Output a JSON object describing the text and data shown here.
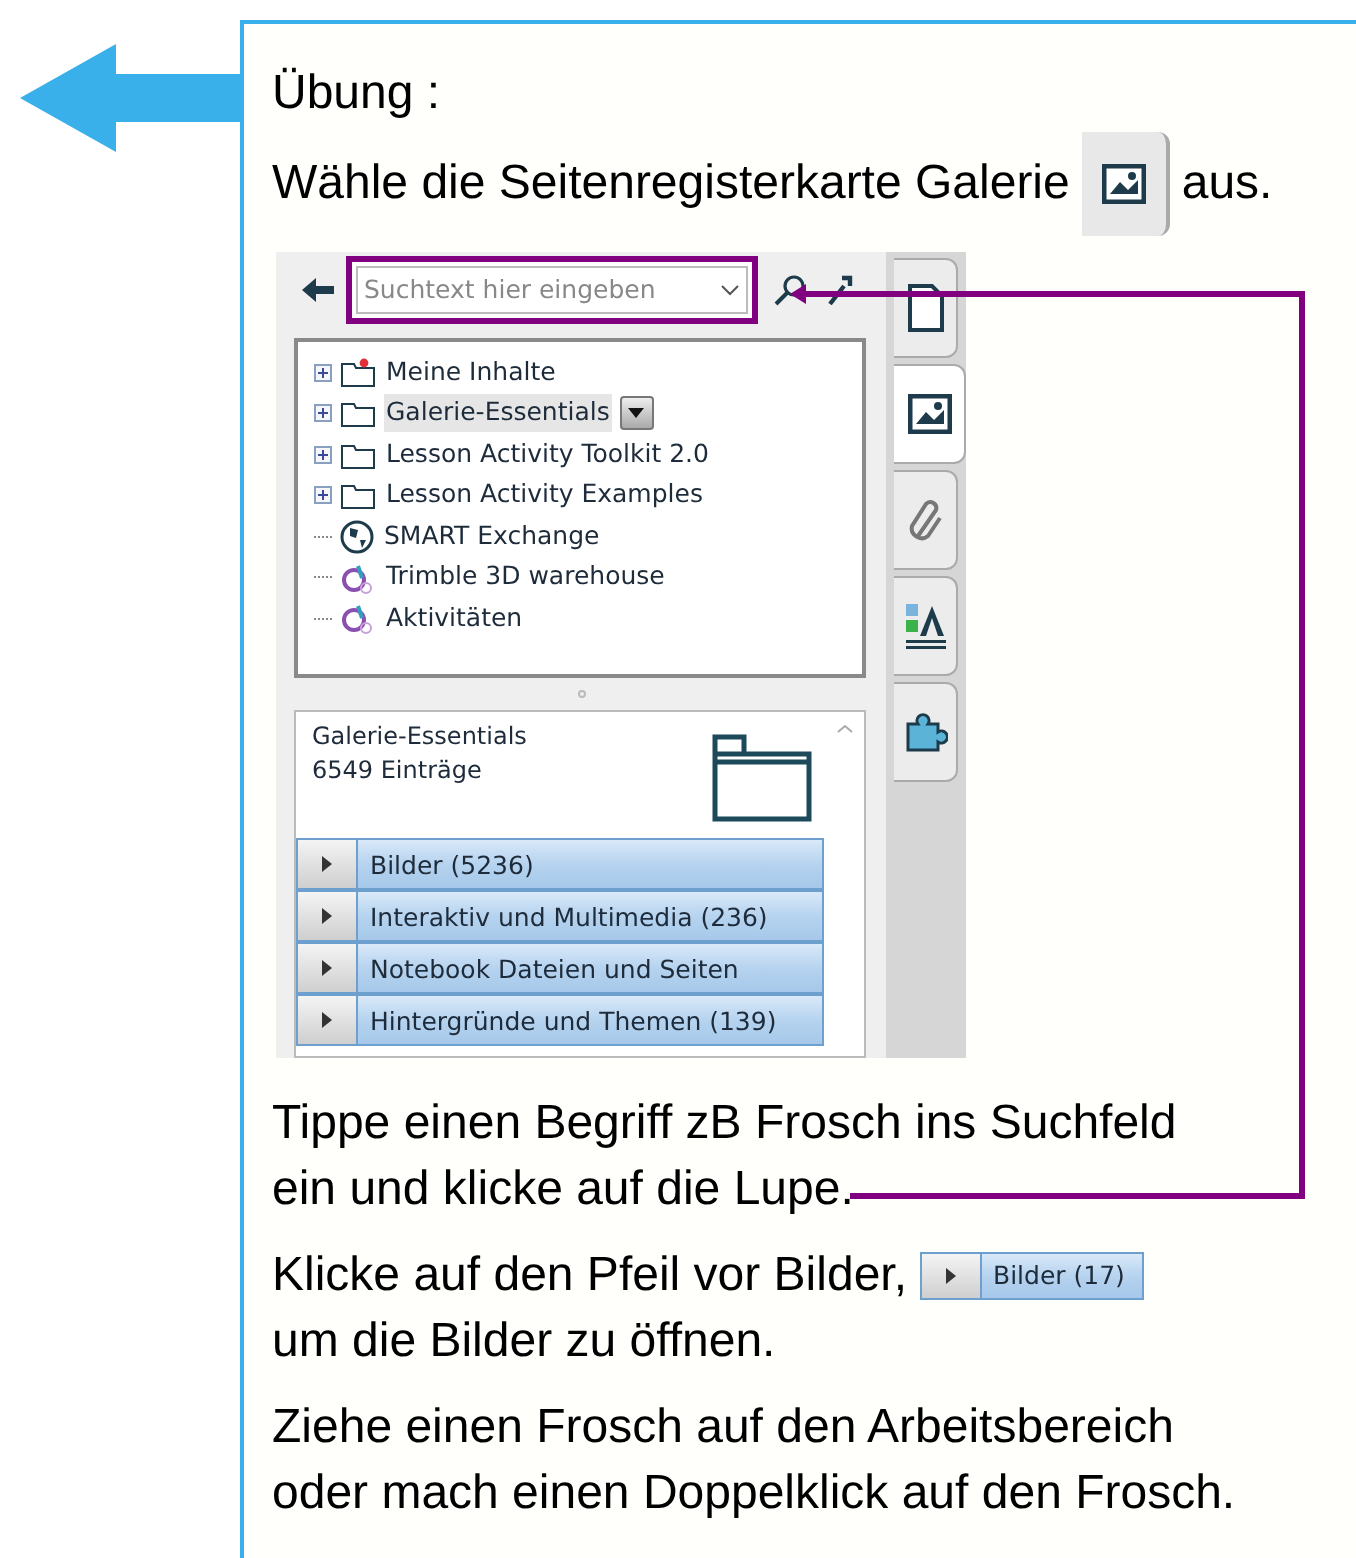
{
  "exercise": {
    "title": "Übung :",
    "instruction": {
      "before": "Wähle die Seitenregisterkarte Galerie",
      "after": "aus."
    }
  },
  "gallery": {
    "search": {
      "placeholder": "Suchtext hier eingeben"
    },
    "tree": [
      {
        "label": "Meine Inhalte",
        "kind": "my_folder",
        "expandable": true,
        "selected": false
      },
      {
        "label": "Galerie-Essentials",
        "kind": "folder",
        "expandable": true,
        "selected": true
      },
      {
        "label": "Lesson Activity Toolkit 2.0",
        "kind": "folder",
        "expandable": true,
        "selected": false
      },
      {
        "label": "Lesson Activity Examples",
        "kind": "folder",
        "expandable": true,
        "selected": false
      },
      {
        "label": "SMART Exchange",
        "kind": "globe",
        "expandable": false,
        "selected": false
      },
      {
        "label": "Trimble 3D warehouse",
        "kind": "link",
        "expandable": false,
        "selected": false
      },
      {
        "label": "Aktivitäten",
        "kind": "link",
        "expandable": false,
        "selected": false
      }
    ],
    "side_tabs": [
      {
        "kind": "page",
        "selected": false
      },
      {
        "kind": "gallery",
        "selected": true
      },
      {
        "kind": "attachments",
        "selected": false
      },
      {
        "kind": "properties",
        "selected": false
      },
      {
        "kind": "addons",
        "selected": false
      }
    ],
    "info": {
      "title": "Galerie-Essentials",
      "count": "6549 Einträge"
    },
    "categories": [
      "Bilder (5236)",
      "Interaktiv und Multimedia (236)",
      "Notebook Dateien und Seiten",
      "Hintergründe und Themen (139)"
    ]
  },
  "steps": [
    {
      "kind": "text",
      "lines": [
        "Tippe einen Begriff zB Frosch ins Suchfeld",
        "ein und klicke auf die Lupe."
      ]
    },
    {
      "kind": "with_bar",
      "before": "Klicke auf den Pfeil vor Bilder,",
      "bar": "Bilder (17)",
      "after": "um die Bilder zu öffnen."
    },
    {
      "kind": "text",
      "lines": [
        "Ziehe einen Frosch auf den Arbeitsbereich",
        "oder mach einen Doppelklick auf den Frosch."
      ]
    }
  ]
}
